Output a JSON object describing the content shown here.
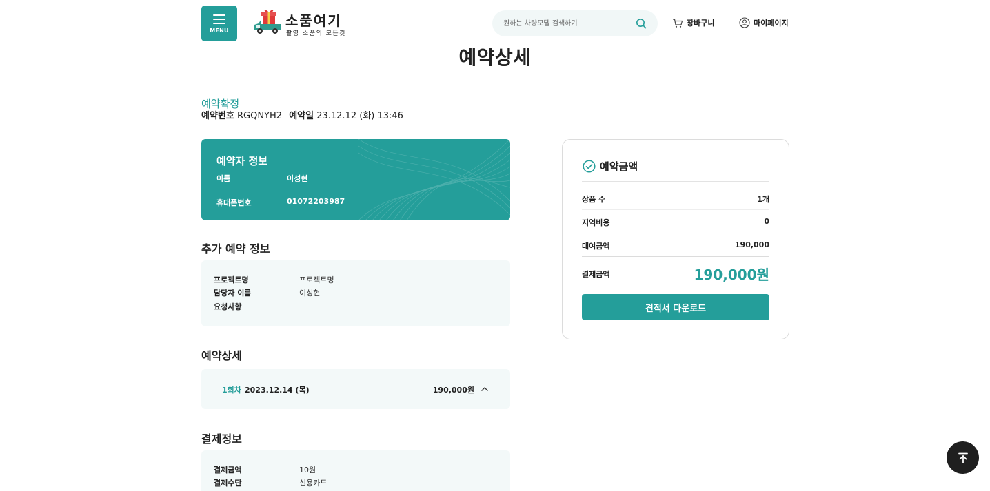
{
  "header": {
    "menu_label": "MENU",
    "logo_name": "소품여기",
    "logo_tagline": "촬영 소품의 모든것",
    "search_placeholder": "원하는 차량모델 검색하기",
    "cart_label": "장바구니",
    "mypage_label": "마이페이지"
  },
  "page_title": "예약상세",
  "reservation": {
    "status": "예약확정",
    "number_label": "예약번호",
    "number": "RGQNYH2",
    "date_label": "예약일",
    "date": "23.12.12 (화) 13:46"
  },
  "reserver": {
    "title": "예약자 정보",
    "name_label": "이름",
    "name": "이성현",
    "phone_label": "휴대폰번호",
    "phone": "01072203987"
  },
  "additional": {
    "title": "추가 예약 정보",
    "rows": [
      {
        "label": "프로젝트명",
        "value": "프로젝트명"
      },
      {
        "label": "담당자 이름",
        "value": "이성현"
      },
      {
        "label": "요청사항",
        "value": ""
      }
    ]
  },
  "detail": {
    "title": "예약상세",
    "round": "1회차",
    "date": "2023.12.14 (목)",
    "price": "190,000원"
  },
  "payment": {
    "title": "결제정보",
    "rows": [
      {
        "label": "결제금액",
        "value": "10원"
      },
      {
        "label": "결제수단",
        "value": "신용카드"
      }
    ]
  },
  "summary": {
    "title": "예약금액",
    "rows": [
      {
        "label": "상품 수",
        "value": "1개"
      },
      {
        "label": "지역비용",
        "value": "0"
      },
      {
        "label": "대여금액",
        "value": "190,000"
      }
    ],
    "total_label": "결제금액",
    "total_value": "190,000원",
    "download_label": "견적서 다운로드"
  },
  "colors": {
    "accent": "#249e9a",
    "light_bg": "#f3f9f9",
    "top_button": "#1f1f1f"
  }
}
